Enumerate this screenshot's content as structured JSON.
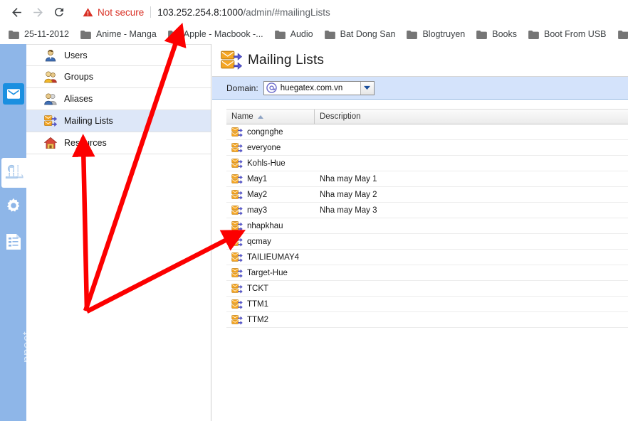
{
  "browser": {
    "back_icon": "back-arrow-icon",
    "forward_icon": "forward-arrow-icon",
    "reload_icon": "reload-icon",
    "security_icon": "warning-triangle-icon",
    "security_label": "Not secure",
    "url_host": "103.252.254.8:1000",
    "url_path": "/admin/#mailingLists",
    "bookmarks": [
      {
        "label": "25-11-2012"
      },
      {
        "label": "Anime - Manga"
      },
      {
        "label": "Apple - Macbook -..."
      },
      {
        "label": "Audio"
      },
      {
        "label": "Bat Dong San"
      },
      {
        "label": "Blogtruyen"
      },
      {
        "label": "Books"
      },
      {
        "label": "Boot From USB"
      },
      {
        "label": ""
      }
    ]
  },
  "rail": {
    "items": [
      {
        "name": "mail-icon",
        "glyph": "✉"
      },
      {
        "name": "users-icon",
        "glyph": ""
      },
      {
        "name": "statistics-icon",
        "glyph": ""
      },
      {
        "name": "settings-gear-icon",
        "glyph": ""
      },
      {
        "name": "documents-icon",
        "glyph": ""
      }
    ],
    "vertical_label": "nnect"
  },
  "nav": {
    "items": [
      {
        "label": "Users",
        "icon": "user-icon",
        "selected": false
      },
      {
        "label": "Groups",
        "icon": "groups-icon",
        "selected": false
      },
      {
        "label": "Aliases",
        "icon": "aliases-icon",
        "selected": false
      },
      {
        "label": "Mailing Lists",
        "icon": "mailing-list-icon",
        "selected": true
      },
      {
        "label": "Resources",
        "icon": "resources-home-icon",
        "selected": false
      }
    ]
  },
  "content": {
    "title": "Mailing Lists",
    "title_icon": "mailing-list-icon",
    "toolbar": {
      "domain_label": "Domain:",
      "domain_icon": "at-sign-icon",
      "domain_value": "huegatex.com.vn",
      "dropdown_icon": "chevron-down-icon"
    },
    "table": {
      "columns": [
        "Name",
        "Description"
      ],
      "sort_column": "Name",
      "sort_direction": "ascending",
      "rows": [
        {
          "name": "congnghe",
          "description": ""
        },
        {
          "name": "everyone",
          "description": ""
        },
        {
          "name": "Kohls-Hue",
          "description": ""
        },
        {
          "name": "May1",
          "description": "Nha may May 1"
        },
        {
          "name": "May2",
          "description": "Nha may May 2"
        },
        {
          "name": "may3",
          "description": "Nha may May 3"
        },
        {
          "name": "nhapkhau",
          "description": ""
        },
        {
          "name": "qcmay",
          "description": ""
        },
        {
          "name": "TAILIEUMAY4",
          "description": ""
        },
        {
          "name": "Target-Hue",
          "description": ""
        },
        {
          "name": "TCKT",
          "description": ""
        },
        {
          "name": "TTM1",
          "description": ""
        },
        {
          "name": "TTM2",
          "description": ""
        }
      ]
    }
  },
  "annotations": {
    "arrow_color": "#fc0000",
    "arrows": [
      {
        "name": "arrow-to-bookmarks-bar"
      },
      {
        "name": "arrow-to-mailing-lists-nav"
      },
      {
        "name": "arrow-to-qcmay-row"
      }
    ]
  },
  "colors": {
    "rail_blue": "#8eb6e8",
    "accent_blue": "#1a8fe0",
    "toolbar_blue": "#d4e3fb",
    "selected_nav": "#dde7f8",
    "not_secure_red": "#d93025"
  }
}
